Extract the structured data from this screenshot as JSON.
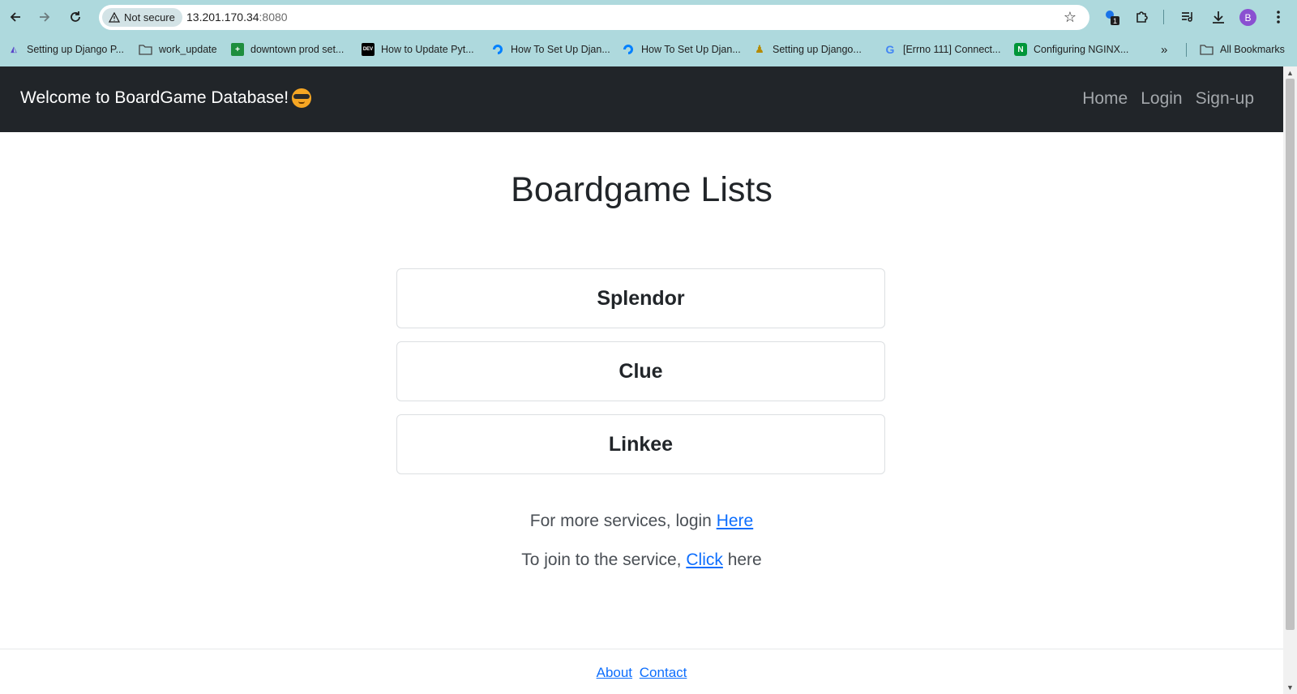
{
  "browser": {
    "security_chip": "Not secure",
    "url_host": "13.201.170.34",
    "url_port": ":8080",
    "profile_initial": "B",
    "extension_badge": "1",
    "bookmarks": [
      {
        "label": "Setting up Django P...",
        "icon": "bookmark-favicon"
      },
      {
        "label": "work_update",
        "icon": "folder-icon"
      },
      {
        "label": "downtown prod set...",
        "icon": "sheets-icon"
      },
      {
        "label": "How to Update Pyt...",
        "icon": "dev-icon"
      },
      {
        "label": "How To Set Up Djan...",
        "icon": "digitalocean-icon"
      },
      {
        "label": "How To Set Up Djan...",
        "icon": "digitalocean-icon"
      },
      {
        "label": "Setting up Django...",
        "icon": "python-icon"
      },
      {
        "label": "[Errno 111] Connect...",
        "icon": "google-icon"
      },
      {
        "label": "Configuring NGINX...",
        "icon": "nginx-icon"
      }
    ],
    "all_bookmarks": "All Bookmarks"
  },
  "navbar": {
    "brand": "Welcome to BoardGame Database!",
    "links": [
      "Home",
      "Login",
      "Sign-up"
    ]
  },
  "main": {
    "title": "Boardgame Lists",
    "games": [
      "Splendor",
      "Clue",
      "Linkee"
    ],
    "login_prefix": "For more services, login ",
    "login_link": "Here",
    "join_prefix": "To join to the service, ",
    "join_link": "Click",
    "join_suffix": " here"
  },
  "footer": {
    "about": "About",
    "contact": "Contact"
  }
}
